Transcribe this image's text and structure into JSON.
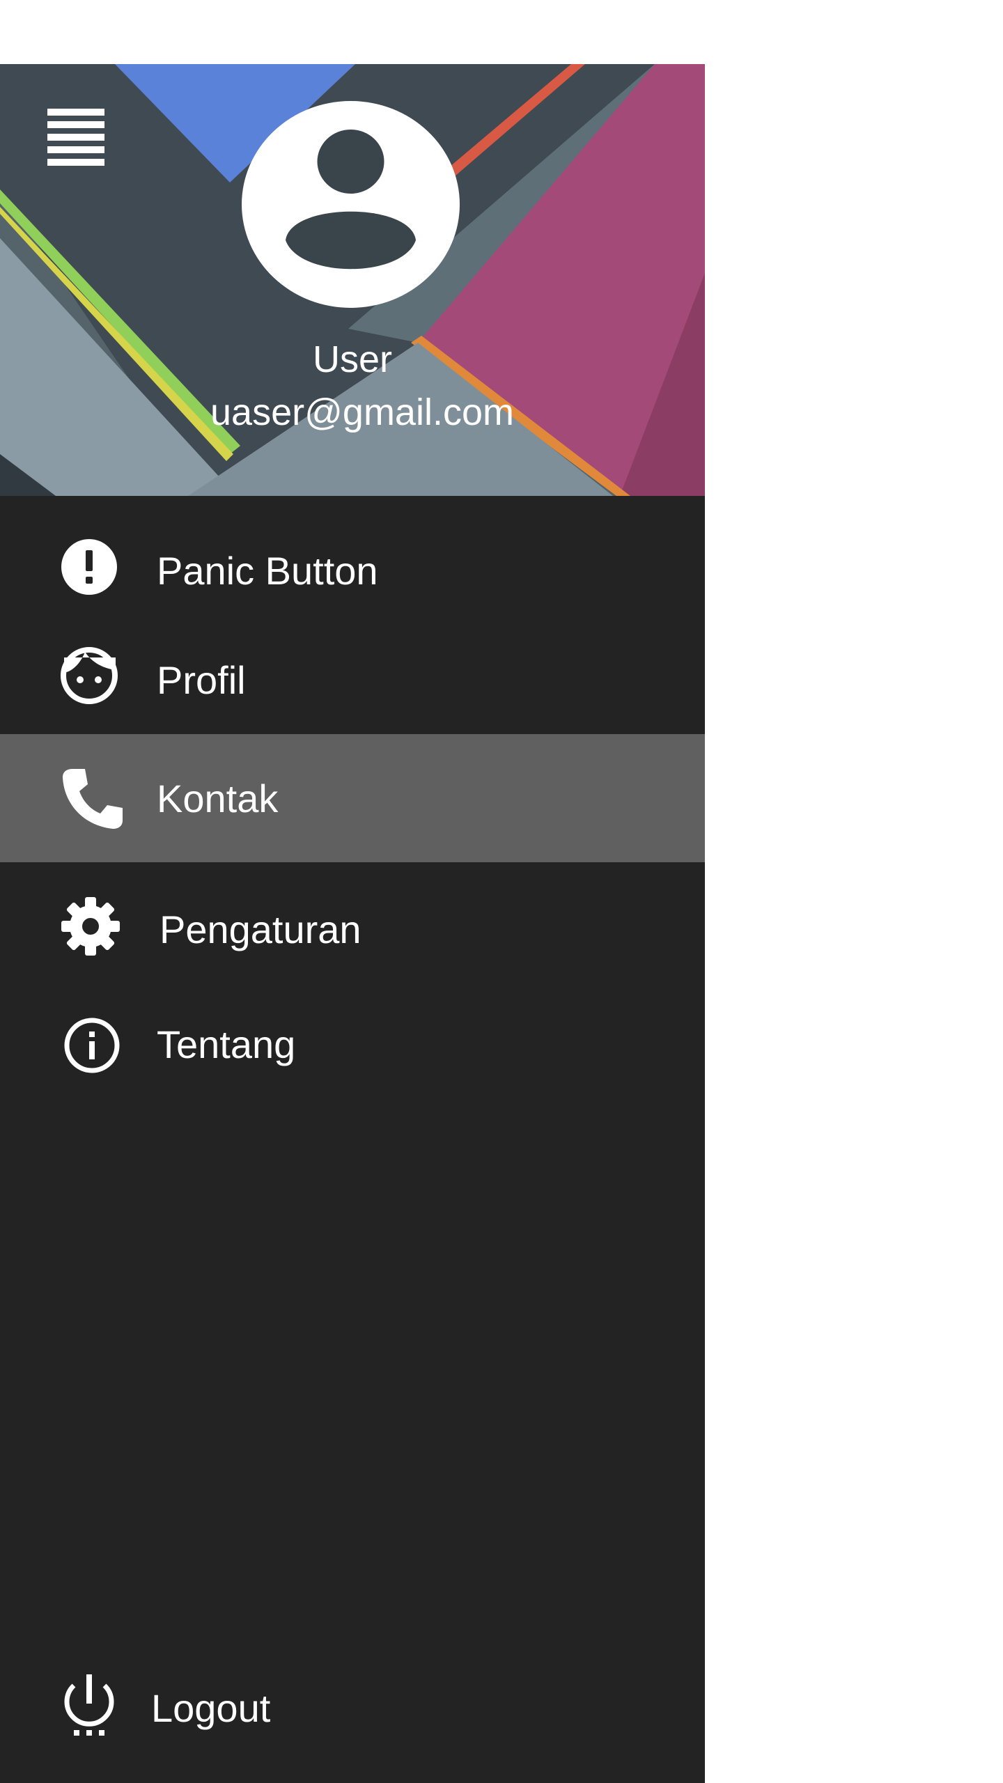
{
  "colors": {
    "drawer_background": "#232323",
    "active_item_background": "#606060",
    "text": "#ffffff",
    "page_background": "#ffffff"
  },
  "header": {
    "menu_icon": "menu-icon",
    "avatar_icon": "account-circle-icon",
    "user_name": "User",
    "user_email": "uaser@gmail.com"
  },
  "menu": {
    "items": [
      {
        "label": "Panic Button",
        "icon": "alert-circle-icon",
        "active": false
      },
      {
        "label": "Profil",
        "icon": "face-icon",
        "active": false
      },
      {
        "label": "Kontak",
        "icon": "phone-icon",
        "active": true
      },
      {
        "label": "Pengaturan",
        "icon": "gear-icon",
        "active": false
      },
      {
        "label": "Tentang",
        "icon": "info-icon",
        "active": false
      }
    ]
  },
  "footer": {
    "logout_label": "Logout",
    "logout_icon": "power-icon"
  }
}
